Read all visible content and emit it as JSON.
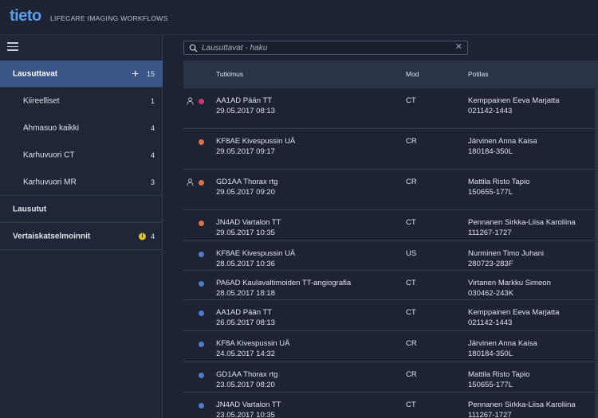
{
  "header": {
    "logo": "tieto",
    "app_title": "LIFECARE IMAGING WORKFLOWS"
  },
  "sidebar": {
    "items": [
      {
        "label": "Lausuttavat",
        "count": "15",
        "active": true,
        "level": 0,
        "plus": true
      },
      {
        "label": "Kiireelliset",
        "count": "1",
        "level": 1
      },
      {
        "label": "Ahmasuo kaikki",
        "count": "4",
        "level": 1
      },
      {
        "label": "Karhuvuori CT",
        "count": "4",
        "level": 1
      },
      {
        "label": "Karhuvuori MR",
        "count": "3",
        "level": 1
      },
      {
        "label": "Lausutut",
        "count": "",
        "level": 0,
        "bold": true
      },
      {
        "label": "Vertaiskatselmoinnit",
        "count": "4",
        "level": 0,
        "bold": true,
        "warning": true
      }
    ],
    "warning_icon": "!"
  },
  "search": {
    "placeholder": "Lausuttavat - haku",
    "value": ""
  },
  "table": {
    "columns": {
      "study": "Tutkimus",
      "mod": "Mod",
      "patient": "Potilas"
    },
    "rows": [
      {
        "study": "AA1AD Pään TT",
        "date": "29.05.2017 08:13",
        "mod": "CT",
        "patient": "Kemppainen Eeva Marjatta",
        "pid": "021142-1443",
        "color": "#d6336c",
        "person": true
      },
      {
        "study": "KF8AE Kivespussin UÄ",
        "date": "29.05.2017 09:17",
        "mod": "CR",
        "patient": "Järvinen Anna Kaisa",
        "pid": "180184-350L",
        "color": "#e36e4a",
        "person": false
      },
      {
        "study": "GD1AA Thorax rtg",
        "date": "29.05.2017 09:20",
        "mod": "CR",
        "patient": "Mattila Risto Tapio",
        "pid": "150655-177L",
        "color": "#e36e4a",
        "person": true
      },
      {
        "study": "JN4AD Vartalon TT",
        "date": "29.05.2017 10:35",
        "mod": "CT",
        "patient": "Pennanen Sirkka-Liisa Karoliina",
        "pid": "111267-1727",
        "color": "#e36e4a",
        "person": false
      },
      {
        "study": "KF8AE Kivespussin UÄ",
        "date": "28.05.2017 10:36",
        "mod": "US",
        "patient": "Nurminen Timo Juhani",
        "pid": "280723-283F",
        "color": "#4f7cc9",
        "person": false
      },
      {
        "study": "PA6AD Kaulavaltimoiden TT-angiografia",
        "date": "28.05.2017 18:18",
        "mod": "CT",
        "patient": "Virtanen Markku Simeon",
        "pid": "030462-243K",
        "color": "#4f7cc9",
        "person": false
      },
      {
        "study": "AA1AD Pään TT",
        "date": "26.05.2017 08:13",
        "mod": "CT",
        "patient": "Kemppainen Eeva Marjatta",
        "pid": "021142-1443",
        "color": "#4f7cc9",
        "person": false
      },
      {
        "study": "KF8A Kivespussin UÄ",
        "date": "24.05.2017 14:32",
        "mod": "CR",
        "patient": "Järvinen Anna Kaisa",
        "pid": "180184-350L",
        "color": "#4f7cc9",
        "person": false
      },
      {
        "study": "GD1AA Thorax rtg",
        "date": "23.05.2017 08:20",
        "mod": "CR",
        "patient": "Mattila Risto Tapio",
        "pid": "150655-177L",
        "color": "#4f7cc9",
        "person": false
      },
      {
        "study": "JN4AD Vartalon TT",
        "date": "23.05.2017 10:35",
        "mod": "CT",
        "patient": "Pennanen Sirkka-Liisa Karoliina",
        "pid": "111267-1727",
        "color": "#4f7cc9",
        "person": false
      }
    ]
  }
}
